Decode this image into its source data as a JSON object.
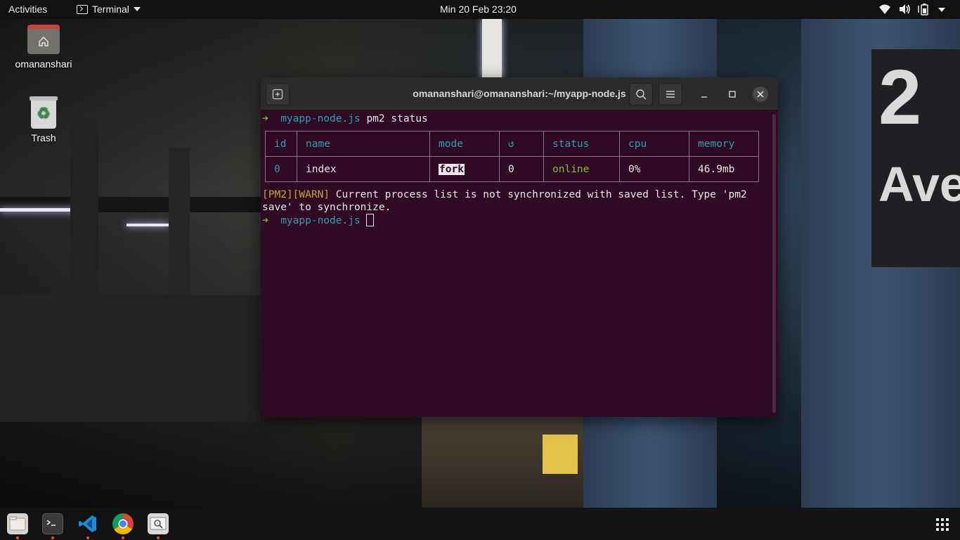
{
  "topbar": {
    "activities": "Activities",
    "app_name": "Terminal",
    "clock": "Min 20 Feb  23:20",
    "tray_icons": [
      "wifi-icon",
      "volume-icon",
      "battery-icon",
      "power-menu-caret-icon"
    ]
  },
  "desktop": {
    "home_label": "omananshari",
    "trash_label": "Trash"
  },
  "terminal": {
    "title": "omananshari@omananshari:~/myapp-node.js",
    "prompt_dir": "myapp-node.js",
    "command": "pm2 status",
    "table": {
      "headers": [
        "id",
        "name",
        "mode",
        "↺",
        "status",
        "cpu",
        "memory"
      ],
      "rows": [
        {
          "id": "0",
          "name": "index",
          "mode": "fork",
          "restarts": "0",
          "status": "online",
          "cpu": "0%",
          "memory": "46.9mb"
        }
      ]
    },
    "warn_tag": "[PM2][WARN]",
    "warn_line1": " Current process list is not synchronized with saved list. Type 'pm2",
    "warn_line2": "save' to synchronize.",
    "prompt_dir2": "myapp-node.js"
  },
  "dock": {
    "apps": [
      "files",
      "terminal",
      "visual-studio-code",
      "google-chrome",
      "document-viewer"
    ]
  },
  "colors": {
    "terminal_bg": "#300a24",
    "prompt_arrow": "#7ec13a",
    "dir": "#2aa1b3",
    "warn": "#c8a43a",
    "accent_dot": "#e95420"
  }
}
